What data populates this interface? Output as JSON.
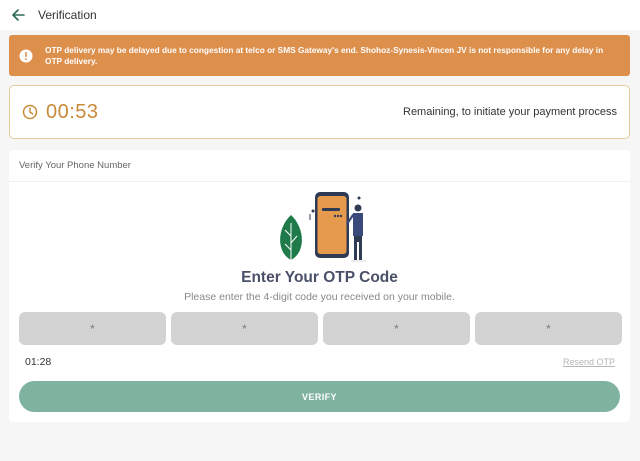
{
  "header": {
    "title": "Verification",
    "back_icon": "arrow-left-icon"
  },
  "warning": {
    "icon": "exclamation-circle-icon",
    "text": "OTP delivery may be delayed due to congestion at telco or SMS Gateway's end. Shohoz-Synesis-Vincen JV is not responsible for any delay in OTP delivery.",
    "color": "#dd8f4c"
  },
  "timer": {
    "icon": "clock-icon",
    "value": "00:53",
    "note": "Remaining, to initiate your payment process",
    "color": "#c98a3a"
  },
  "verify": {
    "section_label": "Verify Your Phone Number",
    "title": "Enter Your OTP Code",
    "subtitle": "Please enter the 4-digit code you received on your mobile.",
    "otp_placeholders": [
      "*",
      "*",
      "*",
      "*"
    ],
    "countdown": "01:28",
    "resend_label": "Resend OTP",
    "button_label": "VERIFY",
    "button_color": "#7fb3a0"
  }
}
